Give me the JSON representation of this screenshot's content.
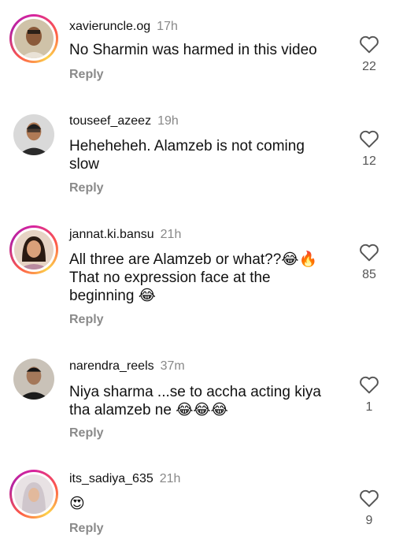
{
  "comments": [
    {
      "username": "xavieruncle.og",
      "time": "17h",
      "text": "No Sharmin was harmed in this video",
      "likes": "22",
      "reply_label": "Reply",
      "avatar_icon": "profile-photo-avatar"
    },
    {
      "username": "touseef_azeez",
      "time": "19h",
      "text": "Heheheheh. Alamzeb is not coming slow",
      "likes": "12",
      "reply_label": "Reply",
      "avatar_icon": "profile-photo-avatar"
    },
    {
      "username": "jannat.ki.bansu",
      "time": "21h",
      "text": "All three are Alamzeb or what??😂🔥 That no expression face at the beginning 😂",
      "likes": "85",
      "reply_label": "Reply",
      "avatar_icon": "profile-photo-avatar"
    },
    {
      "username": "narendra_reels",
      "time": "37m",
      "text": "Niya sharma ...se to accha acting kiya tha alamzeb ne 😂😂😂",
      "likes": "1",
      "reply_label": "Reply",
      "avatar_icon": "profile-photo-avatar"
    },
    {
      "username": "its_sadiya_635",
      "time": "21h",
      "text": "😍",
      "likes": "9",
      "reply_label": "Reply",
      "avatar_icon": "profile-photo-avatar"
    }
  ],
  "icons": {
    "like": "heart-outline-icon"
  },
  "colors": {
    "story_ring": "#d6249f",
    "muted": "#888888"
  }
}
